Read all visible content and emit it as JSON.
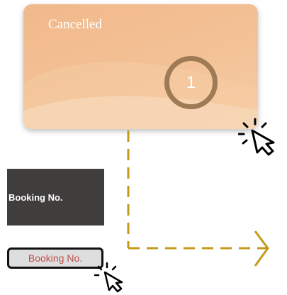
{
  "status_card": {
    "title": "Cancelled",
    "count": "1",
    "color": "#f3c196"
  },
  "buttons": {
    "dark_label": "Booking No.",
    "light_label": "Booking No."
  },
  "icons": {
    "card_cursor": "click-cursor-icon",
    "button_cursor": "click-cursor-icon"
  },
  "connector": {
    "color": "#c49a1b",
    "style": "dashed"
  }
}
